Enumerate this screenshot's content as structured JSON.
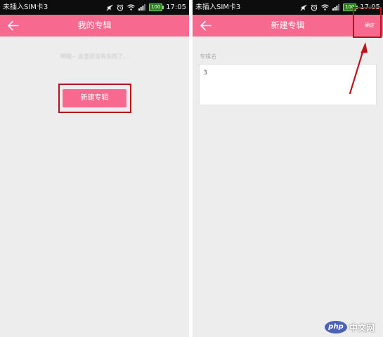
{
  "colors": {
    "accent": "#f7698e",
    "status_bar": "#0d0d0d",
    "screen_background": "#ededed",
    "highlight": "#b5141c"
  },
  "status_bar": {
    "carrier": "未插入SIM卡3",
    "battery": "100",
    "time": "17:05",
    "icons": [
      "mute-icon",
      "alarm-icon",
      "wifi-icon",
      "signal-icon",
      "battery-icon"
    ]
  },
  "left_screen": {
    "title": "我的专辑",
    "empty_hint": "啊哦~ 这里还没有东西了…",
    "new_album_button": "新建专辑"
  },
  "right_screen": {
    "title": "新建专辑",
    "confirm_button": "确定",
    "field_label": "专辑名",
    "field_value": "3"
  },
  "watermark": {
    "badge": "php",
    "text": "中文网"
  }
}
